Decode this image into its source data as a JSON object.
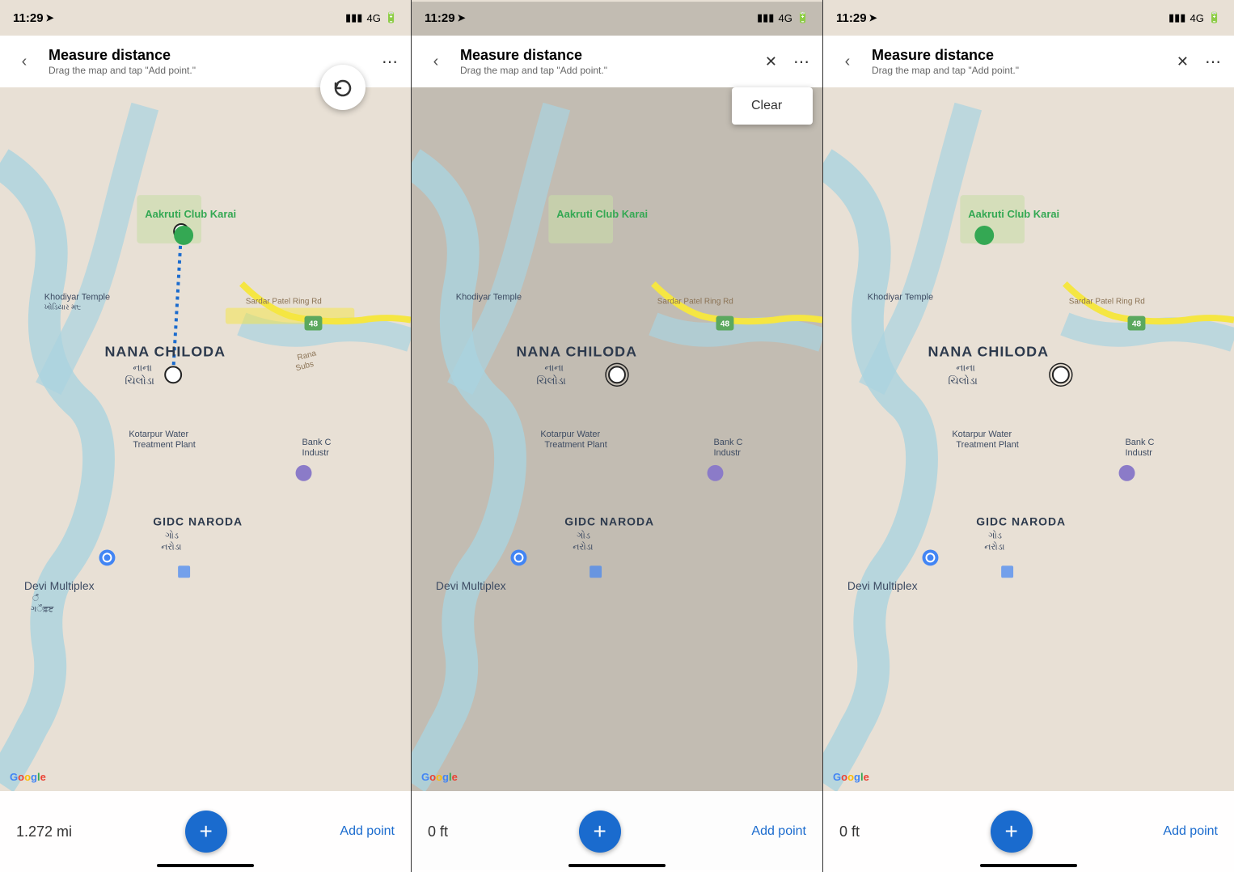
{
  "panels": [
    {
      "id": "panel1",
      "status": {
        "time": "11:29",
        "location_arrow": true,
        "signal": "4G",
        "battery": "■"
      },
      "header": {
        "back_label": "‹",
        "title": "Measure distance",
        "subtitle": "Drag the map and tap \"Add point.\"",
        "has_undo": true,
        "has_x": false,
        "has_dots": true
      },
      "distance": "1.272 mi",
      "add_point_label": "Add point",
      "clear_label": null,
      "has_dropdown": false
    },
    {
      "id": "panel2",
      "status": {
        "time": "11:29",
        "location_arrow": true,
        "signal": "4G",
        "battery": "■"
      },
      "header": {
        "back_label": "‹",
        "title": "Measure distance",
        "subtitle": "Drag the map and tap \"Add point.\"",
        "has_undo": false,
        "has_x": true,
        "has_dots": true
      },
      "distance": "0 ft",
      "add_point_label": "Add point",
      "clear_label": "Clear",
      "has_dropdown": true
    },
    {
      "id": "panel3",
      "status": {
        "time": "11:29",
        "location_arrow": true,
        "signal": "4G",
        "battery": "■"
      },
      "header": {
        "back_label": "‹",
        "title": "Measure distance",
        "subtitle": "Drag the map and tap \"Add point.\"",
        "has_undo": false,
        "has_x": true,
        "has_dots": true
      },
      "distance": "0 ft",
      "add_point_label": "Add point",
      "clear_label": null,
      "has_dropdown": false
    }
  ],
  "map": {
    "locations": [
      "Aakruti Club Karai",
      "Khodiyar Temple",
      "NANA CHILODA",
      "Kotarpur Water Treatment Plant",
      "GIDC NARODA",
      "Devi Multiplex",
      "Sardar Patel Ring Rd"
    ]
  }
}
